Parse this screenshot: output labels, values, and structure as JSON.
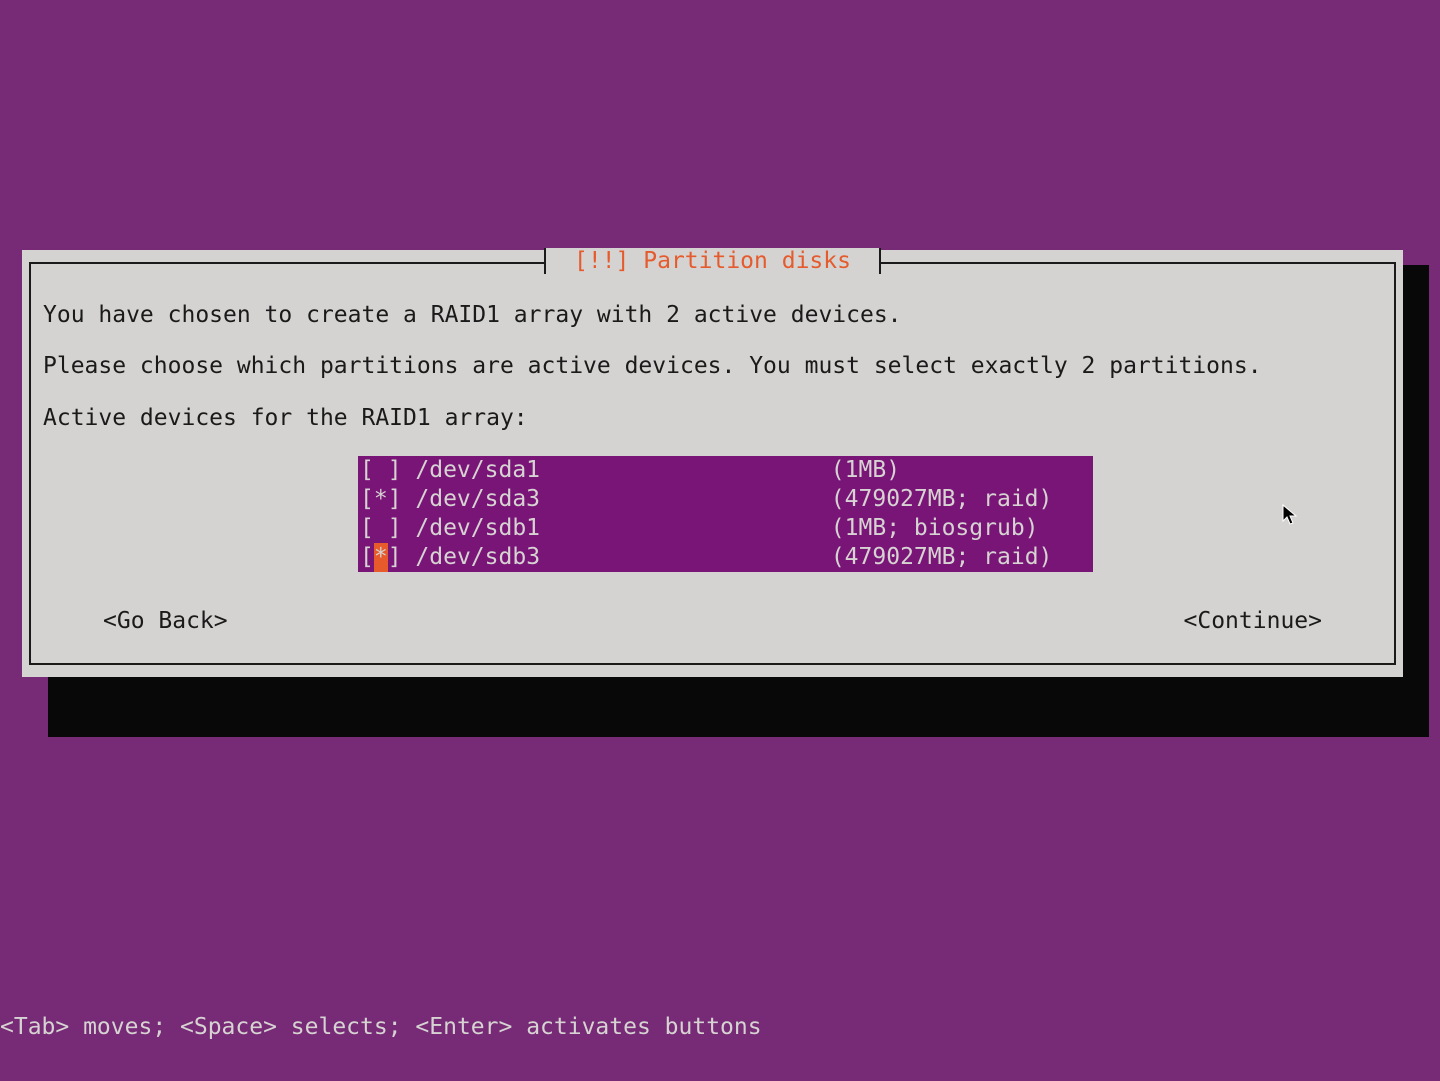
{
  "dialog": {
    "title": "[!!] Partition disks",
    "line1": "You have chosen to create a RAID1 array with 2 active devices.",
    "line2": "Please choose which partitions are active devices. You must select exactly 2 partitions.",
    "line3": "Active devices for the RAID1 array:",
    "go_back": "<Go Back>",
    "continue": "<Continue>"
  },
  "partitions": [
    {
      "checked": false,
      "device": "/dev/sda1",
      "info": "(1MB)",
      "focused": false
    },
    {
      "checked": true,
      "device": "/dev/sda3",
      "info": "(479027MB; raid)",
      "focused": false
    },
    {
      "checked": false,
      "device": "/dev/sdb1",
      "info": "(1MB; biosgrub)",
      "focused": false
    },
    {
      "checked": true,
      "device": "/dev/sdb3",
      "info": "(479027MB; raid)",
      "focused": true
    }
  ],
  "helpbar": "<Tab> moves; <Space> selects; <Enter> activates buttons",
  "colors": {
    "bg": "#772a76",
    "panel": "#d5d3d1",
    "accent": "#e55b2e",
    "listbg": "#7a1578",
    "listfg": "#d6d3d2"
  }
}
